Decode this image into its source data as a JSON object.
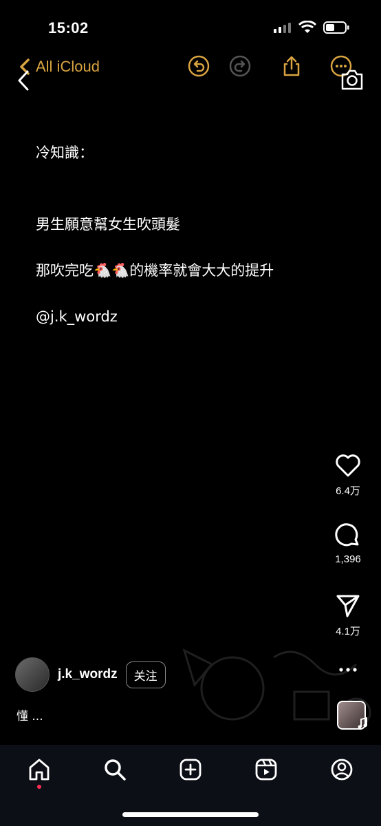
{
  "status_bar": {
    "time": "15:02"
  },
  "notes_toolbar": {
    "back_label": "All iCloud"
  },
  "note": {
    "lines": [
      "冷知識：",
      "男生願意幫女生吹頭髮",
      "那吹完吃🐔🐔的機率就會大大的提升",
      "@j.k_wordz"
    ]
  },
  "actions": {
    "likes": "6.4万",
    "comments": "1,396",
    "shares": "4.1万"
  },
  "post": {
    "username": "j.k_wordz",
    "follow_label": "关注",
    "caption": "懂 ..."
  },
  "nav": {
    "items": [
      "home",
      "search",
      "create",
      "reels",
      "profile"
    ]
  },
  "colors": {
    "accent": "#d9a441",
    "background": "#000000",
    "nav_background": "#0c0f15"
  }
}
